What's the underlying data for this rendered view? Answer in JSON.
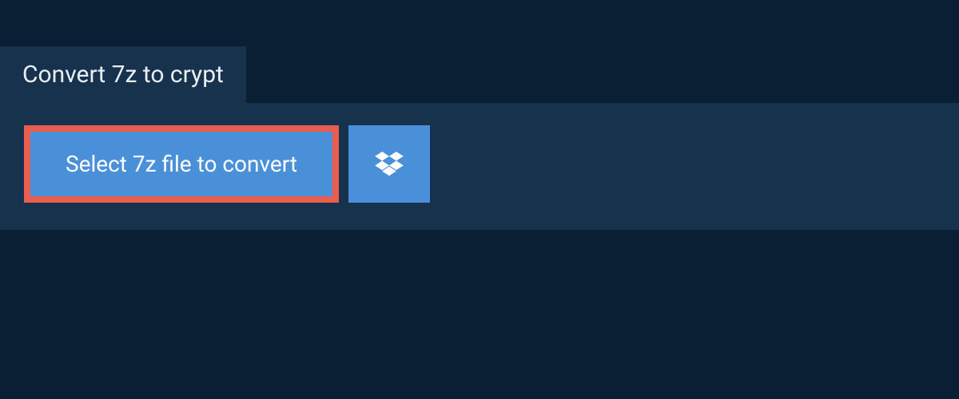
{
  "header": {
    "title": "Convert 7z to crypt"
  },
  "actions": {
    "select_file_label": "Select 7z file to convert",
    "dropbox_icon_name": "dropbox-icon"
  },
  "colors": {
    "background": "#0a1f33",
    "panel": "#17324d",
    "button": "#4a90d9",
    "highlight_border": "#e85d4e",
    "text_light": "#e8eef4",
    "button_text": "#ffffff"
  }
}
